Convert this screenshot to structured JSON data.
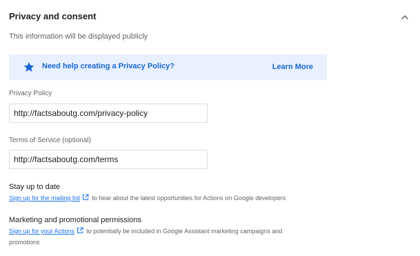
{
  "section": {
    "title": "Privacy and consent",
    "subtitle": "This information will be displayed publicly",
    "collapse_icon": "chevron-up-icon"
  },
  "banner": {
    "icon": "star-icon",
    "message": "Need help creating a Privacy Policy?",
    "link": "Learn More",
    "color": "#1967d2",
    "background": "#e8f0fe"
  },
  "privacy_policy": {
    "label": "Privacy Policy",
    "value": "http://factsaboutg.com/privacy-policy"
  },
  "terms_of_service": {
    "label": "Terms of Service (optional)",
    "value": "http://factsaboutg.com/terms"
  },
  "stay_up_to_date": {
    "title": "Stay up to date",
    "link": "Sign up for the mailing list",
    "text": "to hear about the latest opportunities for Actions on Google developers"
  },
  "marketing": {
    "title": "Marketing and promotional permissions",
    "link": "Sign up for your Actions",
    "text": "to potentially be included in Google Assistant marketing campaigns and promotions"
  }
}
